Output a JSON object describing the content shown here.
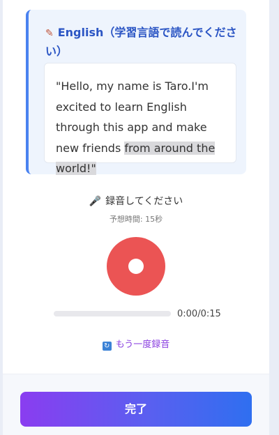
{
  "prompt": {
    "title": "English（学習言語で読んでください）",
    "icon": "pencil-memo-icon",
    "text_main": "\"Hello, my name is Taro.I'm excited to learn English through this app and make new friends ",
    "text_highlight": "from around the world!\""
  },
  "recording": {
    "label": "録音してください",
    "label_icon": "microphone-icon",
    "estimate": "予想時間: 15秒",
    "time": "0:00/0:15",
    "progress": 0,
    "retry_label": "もう一度録音",
    "retry_icon": "repeat-icon"
  },
  "footer": {
    "done_label": "完了"
  },
  "colors": {
    "accent_blue": "#4a82f0",
    "record_red": "#eb5454",
    "retry_purple": "#8a3fe0"
  }
}
